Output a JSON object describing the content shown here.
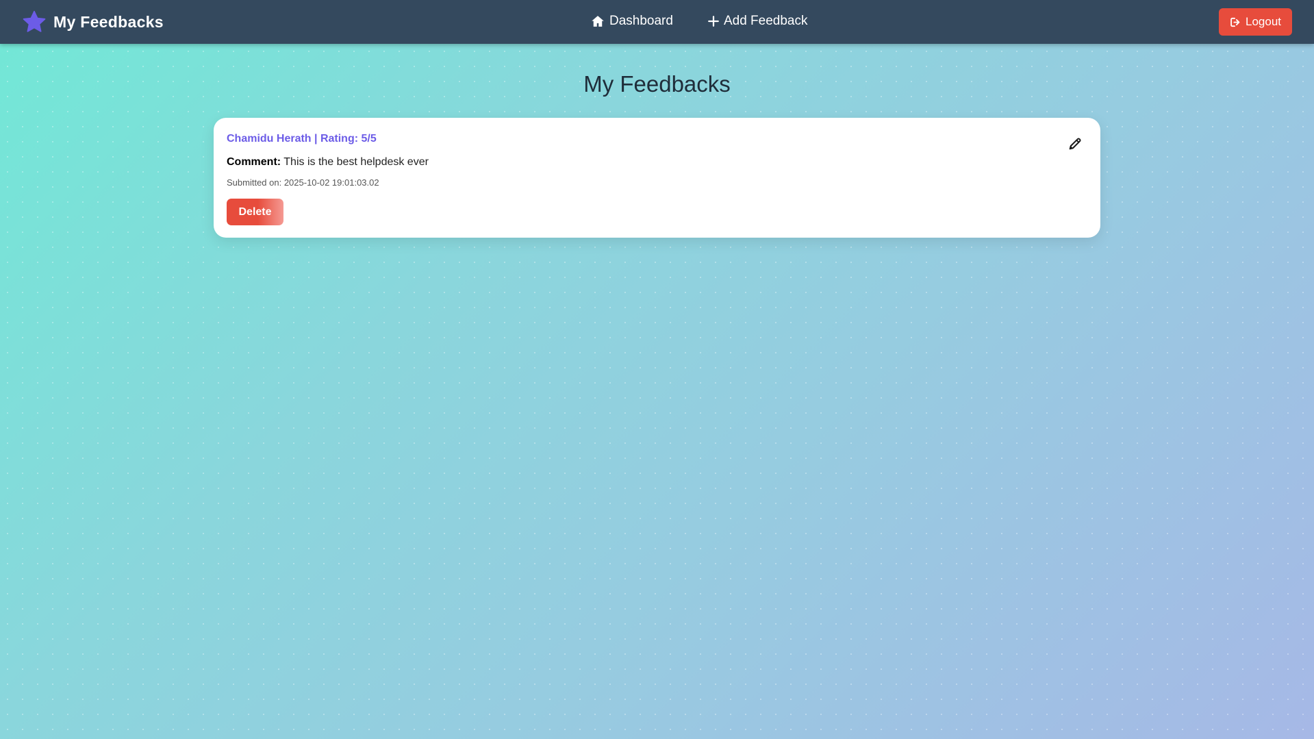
{
  "navbar": {
    "brand_title": "My Feedbacks",
    "links": {
      "dashboard": "Dashboard",
      "add_feedback": "Add Feedback"
    },
    "logout_label": "Logout"
  },
  "main": {
    "page_title": "My Feedbacks",
    "feedbacks": [
      {
        "header": "Chamidu Herath | Rating: 5/5",
        "comment_label": "Comment:",
        "comment": "This is the best helpdesk ever",
        "submitted": "Submitted on: 2025-10-02 19:01:03.02",
        "delete_label": "Delete",
        "edit_icon": "pencil-icon"
      }
    ]
  },
  "colors": {
    "navbar_bg": "#34495e",
    "accent": "#6c5ce7",
    "danger": "#e74c3c"
  },
  "icons": {
    "brand": "star-icon",
    "dashboard": "home-icon",
    "add_feedback": "plus-icon",
    "logout": "logout-icon",
    "edit": "pencil-icon"
  }
}
